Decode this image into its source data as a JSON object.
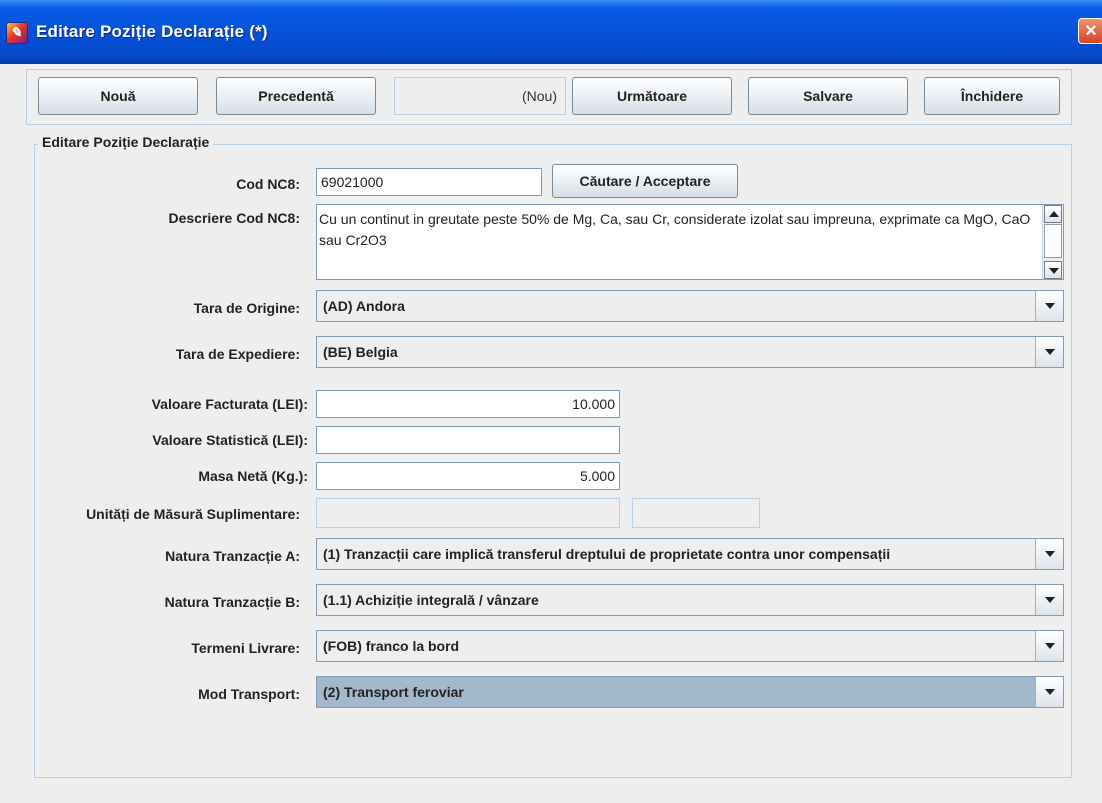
{
  "window": {
    "title": "Editare Poziție Declarație (*)"
  },
  "toolbar": {
    "new_label": "Nouă",
    "prev_label": "Precedentă",
    "position_status": "(Nou)",
    "next_label": "Următoare",
    "save_label": "Salvare",
    "close_label": "Închidere"
  },
  "form": {
    "group_title": "Editare Poziție Declarație",
    "cod_nc8": {
      "label": "Cod NC8:",
      "value": "69021000",
      "search_button": "Căutare / Acceptare"
    },
    "descriere": {
      "label": "Descriere Cod NC8:",
      "value": "Cu un continut in greutate peste 50% de Mg, Ca, sau Cr, considerate izolat sau impreuna, exprimate ca MgO, CaO sau Cr2O3"
    },
    "tara_origine": {
      "label": "Tara de Origine:",
      "value": "(AD) Andora"
    },
    "tara_expediere": {
      "label": "Tara de Expediere:",
      "value": "(BE) Belgia"
    },
    "valoare_facturata": {
      "label": "Valoare Facturata (LEI):",
      "value": "10.000"
    },
    "valoare_statistica": {
      "label": "Valoare Statistică (LEI):",
      "value": ""
    },
    "masa_neta": {
      "label": "Masa Netă (Kg.):",
      "value": "5.000"
    },
    "unitati_suplimentare": {
      "label": "Unități de Măsură Suplimentare:",
      "value": "",
      "unit": ""
    },
    "natura_a": {
      "label": "Natura Tranzacție A:",
      "value": "(1) Tranzacții care implică transferul dreptului de proprietate contra unor compensații"
    },
    "natura_b": {
      "label": "Natura Tranzacție B:",
      "value": "(1.1) Achiziție integrală / vânzare"
    },
    "termeni_livrare": {
      "label": "Termeni Livrare:",
      "value": "(FOB) franco la bord"
    },
    "mod_transport": {
      "label": "Mod Transport:",
      "value": "(2) Transport feroviar"
    }
  },
  "icons": [
    "app-icon",
    "close-icon",
    "chevron-down-icon",
    "scroll-up-icon",
    "scroll-down-icon"
  ],
  "colors": {
    "titlebar": "#0552d8",
    "selected_combo": "#a3b8cc",
    "panel_border": "#b8cfe5"
  }
}
